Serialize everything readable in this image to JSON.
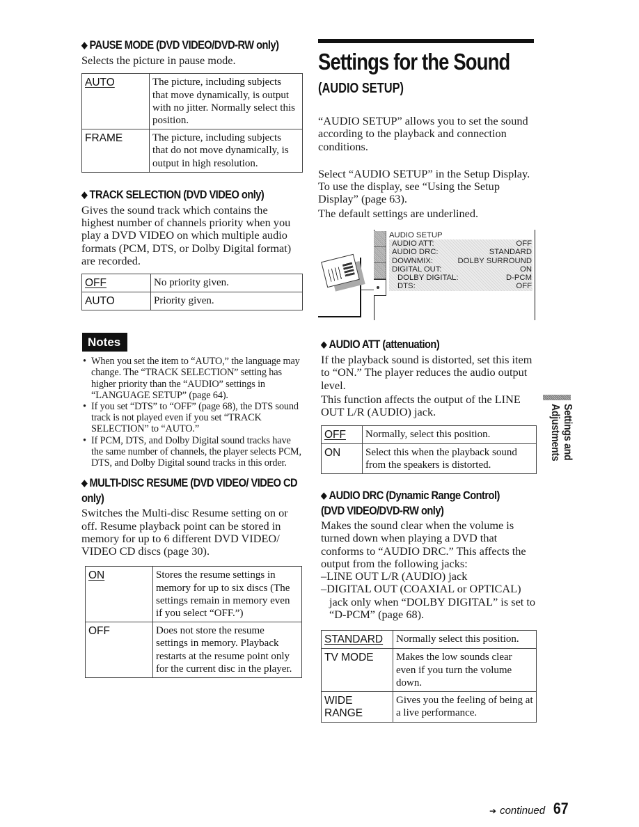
{
  "page_number": "67",
  "footer": {
    "continued_label": "continued",
    "arrow_icon": "arrow-right-icon"
  },
  "side_tab": {
    "label": "Settings and Adjustments"
  },
  "left_column": {
    "pause_mode": {
      "heading": "PAUSE MODE (DVD VIDEO/DVD-RW only)",
      "description": "Selects the picture in pause mode.",
      "options": [
        {
          "key": "AUTO",
          "default": true,
          "text": "The picture, including subjects that move dynamically, is output with no jitter. Normally select this position."
        },
        {
          "key": "FRAME",
          "default": false,
          "text": "The picture, including subjects that do not move dynamically, is output in high resolution."
        }
      ]
    },
    "track_selection": {
      "heading": "TRACK SELECTION (DVD VIDEO only)",
      "description": "Gives the sound track which contains the highest number of channels priority when you play a DVD VIDEO on which multiple audio formats (PCM, DTS, or Dolby Digital format) are recorded.",
      "options": [
        {
          "key": "OFF",
          "default": true,
          "text": "No priority given."
        },
        {
          "key": "AUTO",
          "default": false,
          "text": "Priority given."
        }
      ]
    },
    "notes": {
      "badge": "Notes",
      "items": [
        "When you set the item to “AUTO,” the language may change. The “TRACK SELECTION” setting has higher priority than the “AUDIO” settings in “LANGUAGE SETUP” (page 64).",
        "If you set “DTS” to “OFF” (page 68), the DTS sound track is not played even if you set “TRACK SELECTION” to “AUTO.”",
        "If PCM, DTS, and Dolby Digital sound tracks have the same number of channels, the player selects PCM, DTS, and Dolby Digital sound tracks in this order."
      ]
    },
    "multi_disc_resume": {
      "heading": "MULTI-DISC RESUME (DVD VIDEO/ VIDEO CD only)",
      "description": "Switches the Multi-disc Resume setting on or off. Resume playback point can be stored in memory for up to 6 different DVD VIDEO/ VIDEO CD discs (page 30).",
      "options": [
        {
          "key": "ON",
          "default": true,
          "text": "Stores the resume settings in memory for up to six discs (The settings remain in memory even if you select “OFF.”)"
        },
        {
          "key": "OFF",
          "default": false,
          "text": "Does not store the resume settings in memory. Playback restarts at the resume point only for the current disc in the player."
        }
      ]
    }
  },
  "right_column": {
    "title": "Settings for the Sound",
    "subtitle": "(AUDIO SETUP)",
    "intro_1": "“AUDIO SETUP” allows you to set the sound according to the playback and connection conditions.",
    "intro_2": "Select “AUDIO SETUP” in the Setup Display. To use the display, see “Using the Setup Display” (page 63).",
    "intro_3": "The default settings are underlined.",
    "setup_display": {
      "menu_title": "AUDIO SETUP",
      "rows": [
        {
          "label": "AUDIO ATT:",
          "value": "OFF",
          "indent": false
        },
        {
          "label": "AUDIO DRC:",
          "value": "STANDARD",
          "indent": false
        },
        {
          "label": "DOWNMIX:",
          "value": "DOLBY SURROUND",
          "indent": false
        },
        {
          "label": "DIGITAL OUT:",
          "value": "ON",
          "indent": false
        },
        {
          "label": "DOLBY DIGITAL:",
          "value": "D-PCM",
          "indent": true
        },
        {
          "label": "DTS:",
          "value": "OFF",
          "indent": true
        }
      ]
    },
    "audio_att": {
      "heading": "AUDIO ATT (attenuation)",
      "description_1": "If the playback sound is distorted, set this item to “ON.” The player reduces the audio output level.",
      "description_2": "This function affects the output of the LINE OUT L/R (AUDIO) jack.",
      "options": [
        {
          "key": "OFF",
          "default": true,
          "text": "Normally, select this position."
        },
        {
          "key": "ON",
          "default": false,
          "text": "Select this when the playback sound from the speakers is distorted."
        }
      ]
    },
    "audio_drc": {
      "heading_1": "AUDIO DRC (Dynamic Range Control)",
      "heading_2": "(DVD VIDEO/DVD-RW only)",
      "description": "Makes the sound clear when the volume is turned down when playing a DVD that conforms to “AUDIO DRC.” This affects the output from the following jacks:",
      "bullets": [
        "LINE OUT L/R (AUDIO) jack",
        "DIGITAL OUT (COAXIAL or OPTICAL) jack only when “DOLBY DIGITAL” is set to “D-PCM” (page 68)."
      ],
      "options": [
        {
          "key": "STANDARD",
          "default": true,
          "text": "Normally select this position."
        },
        {
          "key": "TV MODE",
          "default": false,
          "text": "Makes the low sounds clear even if you turn the volume down."
        },
        {
          "key": "WIDE RANGE",
          "default": false,
          "text": "Gives you the feeling of being at a live performance."
        }
      ]
    }
  }
}
